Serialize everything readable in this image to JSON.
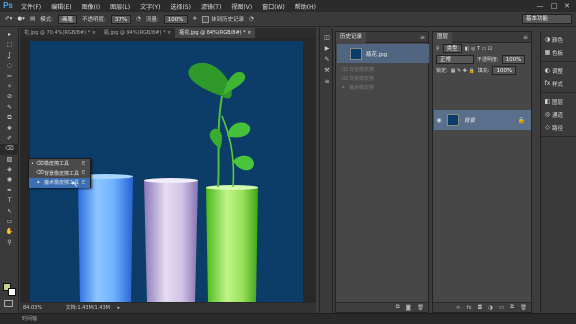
{
  "app": {
    "logo": "Ps"
  },
  "menu": [
    "文件(F)",
    "编辑(E)",
    "图像(I)",
    "图层(L)",
    "文字(Y)",
    "选择(S)",
    "滤镜(T)",
    "视图(V)",
    "窗口(W)",
    "帮助(H)"
  ],
  "window_controls": {
    "minimize": "—",
    "maximize": "□",
    "close": "✕"
  },
  "options": {
    "mode_label": "模式:",
    "mode_value": "画笔",
    "opacity_label": "不透明度:",
    "opacity_value": "37%",
    "flow_label": "流量:",
    "flow_value": "100%",
    "erase_history_label": "抹到历史记录",
    "workspace": "基本功能"
  },
  "doc_tabs": [
    "花.jpg @ 70.4%(RGB/8#) *",
    "瓶.jpg @ 94%(RGB/8#) *",
    "瓶花.jpg @ 84%(RGB/8#) *"
  ],
  "status": {
    "zoom": "84.03%",
    "doc_label": "文档:1.43M/1.43M"
  },
  "bottom": {
    "timeline": "时间轴"
  },
  "flyout": [
    {
      "label": "橡皮擦工具",
      "key": "E",
      "selected": false,
      "active": true
    },
    {
      "label": "背景橡皮擦工具",
      "key": "E",
      "selected": false,
      "active": false
    },
    {
      "label": "魔术橡皮擦工具",
      "key": "E",
      "selected": true,
      "active": false
    }
  ],
  "history": {
    "title": "历史记录",
    "snapshot": "瓶花.jpg",
    "rows": [
      "背景橡皮擦",
      "背景橡皮擦",
      "魔术橡皮擦"
    ]
  },
  "layers": {
    "title": "图层",
    "kind_label": "类型",
    "blend_mode": "正常",
    "opacity_label": "不透明度:",
    "opacity_value": "100%",
    "lock_label": "锁定:",
    "fill_label": "填充:",
    "fill_value": "100%",
    "layer_name": "背景"
  },
  "right_panels": [
    {
      "icon": "color-icon",
      "glyph": "◑",
      "label": "颜色"
    },
    {
      "icon": "swatches-icon",
      "glyph": "▦",
      "label": "色板"
    },
    {
      "icon": "adjustments-icon",
      "glyph": "◐",
      "label": "调整"
    },
    {
      "icon": "styles-icon",
      "glyph": "fx",
      "label": "样式"
    },
    {
      "icon": "layers-icon",
      "glyph": "◧",
      "label": "图层"
    },
    {
      "icon": "channels-icon",
      "glyph": "◎",
      "label": "通道"
    },
    {
      "icon": "paths-icon",
      "glyph": "◇",
      "label": "路径"
    }
  ],
  "tools": [
    "▸",
    "⬚",
    "ʆ",
    "◌",
    "✂",
    "✧",
    "⊘",
    "✎",
    "⧉",
    "❖",
    "✐",
    "⌫",
    "▧",
    "◈",
    "◉",
    "✒",
    "T",
    "↖",
    "▭",
    "✋",
    "⚲"
  ],
  "colors": {
    "canvas_bg": "#0c3d69",
    "accent": "#3b6fb5"
  }
}
